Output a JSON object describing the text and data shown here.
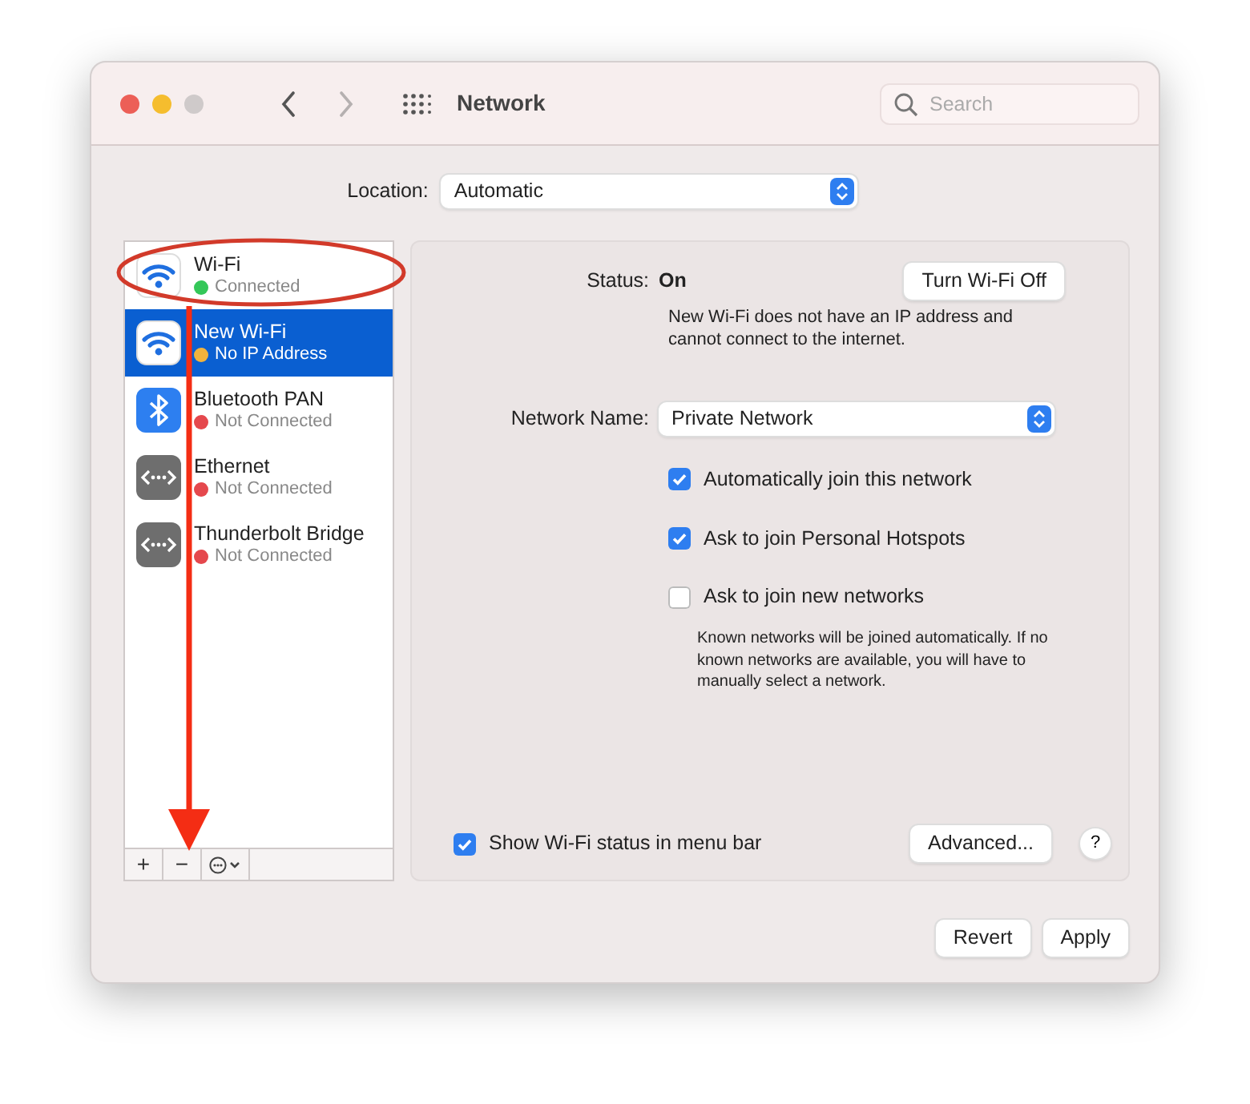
{
  "window": {
    "title": "Network",
    "traffic_lights": [
      {
        "kind": "close"
      },
      {
        "kind": "minimize"
      },
      {
        "kind": "zoom"
      }
    ],
    "back_disabled": false,
    "forward_disabled": true
  },
  "search": {
    "placeholder": "Search"
  },
  "location": {
    "label": "Location:",
    "value": "Automatic"
  },
  "services": [
    {
      "name": "Wi-Fi",
      "status": "Connected",
      "color": "#34c759",
      "kind": "wifi",
      "selected": false
    },
    {
      "name": "New Wi-Fi",
      "status": "No IP Address",
      "color": "#f2b33d",
      "kind": "wifi",
      "selected": true
    },
    {
      "name": "Bluetooth PAN",
      "status": "Not Connected",
      "color": "#e5484d",
      "kind": "bluetooth",
      "selected": false
    },
    {
      "name": "Ethernet",
      "status": "Not Connected",
      "color": "#e5484d",
      "kind": "ethernet",
      "selected": false
    },
    {
      "name": "Thunderbolt Bridge",
      "status": "Not Connected",
      "color": "#e5484d",
      "kind": "ethernet",
      "selected": false
    }
  ],
  "list_toolbar": [
    "+",
    "−"
  ],
  "detail": {
    "status_label": "Status:",
    "status_value": "On",
    "toggle_button": "Turn Wi-Fi Off",
    "description": "New Wi-Fi does not have an IP address and cannot connect to the internet.",
    "network_label": "Network Name:",
    "network_value": "Private Network",
    "options": [
      {
        "label": "Automatically join this network",
        "checked": true
      },
      {
        "label": "Ask to join Personal Hotspots",
        "checked": true
      },
      {
        "label": "Ask to join new networks",
        "checked": false
      }
    ],
    "note": "Known networks will be joined automatically. If no known networks are available, you will have to manually select a network.",
    "menu_bar_option": {
      "label": "Show Wi-Fi status in menu bar",
      "checked": true
    },
    "advanced_button": "Advanced...",
    "help": "?"
  },
  "footer_buttons": [
    "Revert",
    "Apply"
  ]
}
